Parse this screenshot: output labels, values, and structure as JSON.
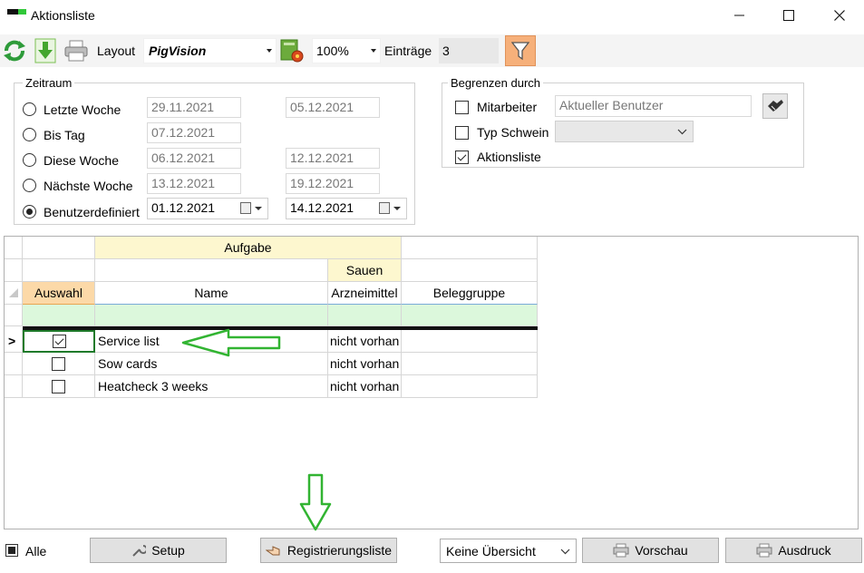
{
  "window": {
    "title": "Aktionsliste"
  },
  "toolbar": {
    "layout_label": "Layout",
    "layout_value": "PigVision",
    "zoom_value": "100%",
    "entries_label": "Einträge",
    "entries_value": "3"
  },
  "zeitraum": {
    "title": "Zeitraum",
    "options": [
      {
        "label": "Letzte Woche",
        "from": "29.11.2021",
        "to": "05.12.2021",
        "checked": false
      },
      {
        "label": "Bis Tag",
        "from": "07.12.2021",
        "to": "",
        "checked": false
      },
      {
        "label": "Diese Woche",
        "from": "06.12.2021",
        "to": "12.12.2021",
        "checked": false
      },
      {
        "label": "Nächste Woche",
        "from": "13.12.2021",
        "to": "19.12.2021",
        "checked": false
      },
      {
        "label": "Benutzerdefiniert",
        "from": "01.12.2021",
        "to": "14.12.2021",
        "checked": true
      }
    ]
  },
  "begrenzen": {
    "title": "Begrenzen durch",
    "mitarbeiter_label": "Mitarbeiter",
    "mitarbeiter_value": "Aktueller Benutzer",
    "typ_schwein_label": "Typ Schwein",
    "typ_schwein_value": "",
    "aktionsliste_label": "Aktionsliste"
  },
  "grid": {
    "band_aufgabe": "Aufgabe",
    "band_sauen": "Sauen",
    "col_auswahl": "Auswahl",
    "col_name": "Name",
    "col_arzneimittel": "Arzneimittel",
    "col_beleggruppe": "Beleggruppe",
    "row_indicator": ">",
    "rows": [
      {
        "checked": true,
        "name": "Service list",
        "arzneimittel": "nicht vorhan",
        "beleggruppe": ""
      },
      {
        "checked": false,
        "name": "Sow cards",
        "arzneimittel": "nicht vorhan",
        "beleggruppe": ""
      },
      {
        "checked": false,
        "name": "Heatcheck 3 weeks",
        "arzneimittel": "nicht vorhan",
        "beleggruppe": ""
      }
    ]
  },
  "bottom": {
    "alle_label": "Alle",
    "setup_label": "Setup",
    "registrierungsliste_label": "Registrierungsliste",
    "uebersicht_value": "Keine Übersicht",
    "vorschau_label": "Vorschau",
    "ausdruck_label": "Ausdruck"
  },
  "colors": {
    "accent_orange": "#fcd9a8",
    "header_yellow": "#fdf7cf",
    "filter_green": "#dcf8dc",
    "annotation_green": "#32b432"
  }
}
